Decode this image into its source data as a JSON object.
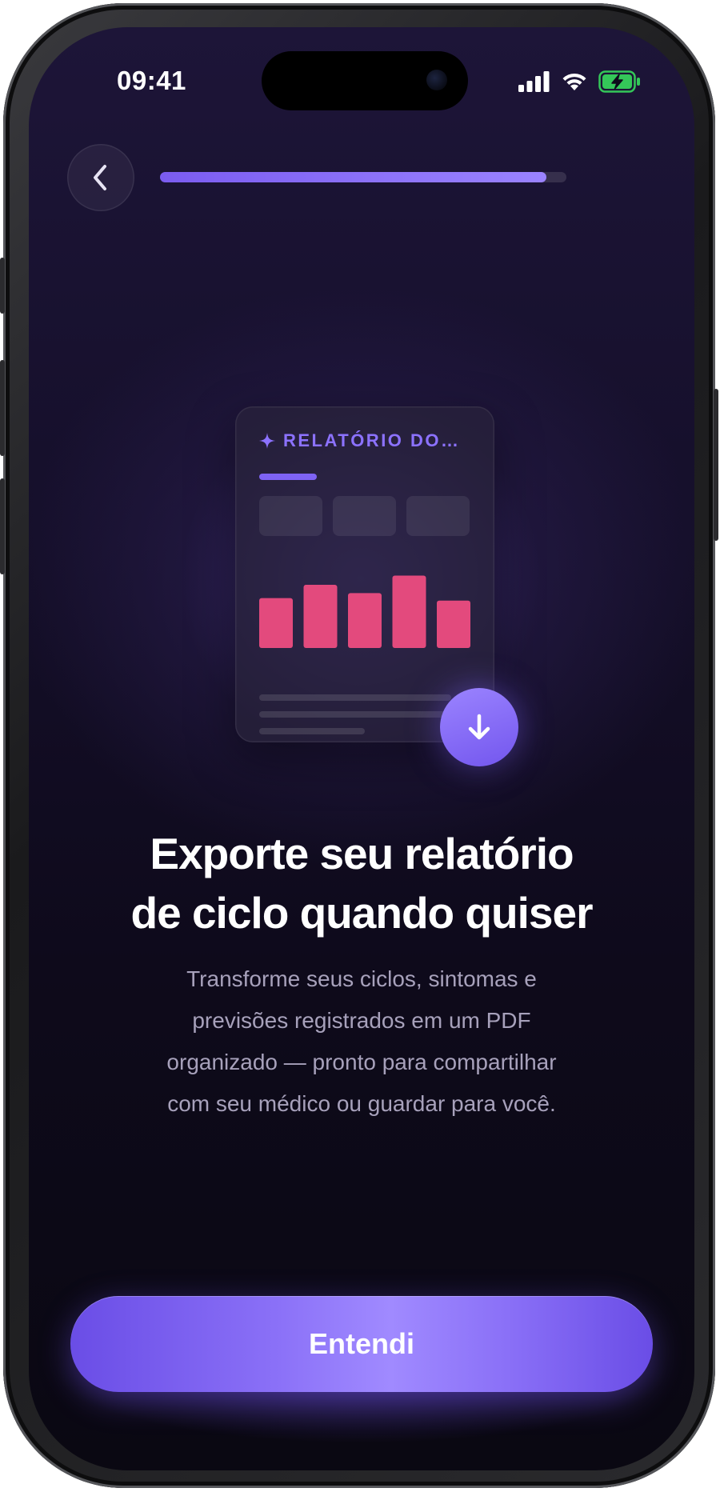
{
  "status_bar": {
    "time": "09:41",
    "icons": [
      "cellular-signal-icon",
      "wifi-icon",
      "battery-charging-icon"
    ],
    "battery_color": "#34c759"
  },
  "nav": {
    "back_icon": "chevron-left-icon",
    "progress_fraction": 0.95
  },
  "illustration": {
    "sparkle_icon": "sparkle-icon",
    "report_title": "RELATÓRIO DO…",
    "bar_values": [
      0.6,
      0.76,
      0.66,
      0.87,
      0.57
    ],
    "bar_color": "#e34a7d",
    "download_icon": "arrow-down-icon"
  },
  "content": {
    "headline_line1": "Exporte seu relatório",
    "headline_line2": "de ciclo quando quiser",
    "body_line1": "Transforme seus ciclos, sintomas e",
    "body_line2": "previsões registrados em um PDF",
    "body_line3": "organizado — pronto para compartilhar",
    "body_line4": "com seu médico ou guardar para você."
  },
  "cta": {
    "label": "Entendi"
  },
  "colors": {
    "accent": "#7b5cf0",
    "background_top": "#1d1538",
    "background_bottom": "#0a0812",
    "body_text": "#a7a1bb"
  }
}
